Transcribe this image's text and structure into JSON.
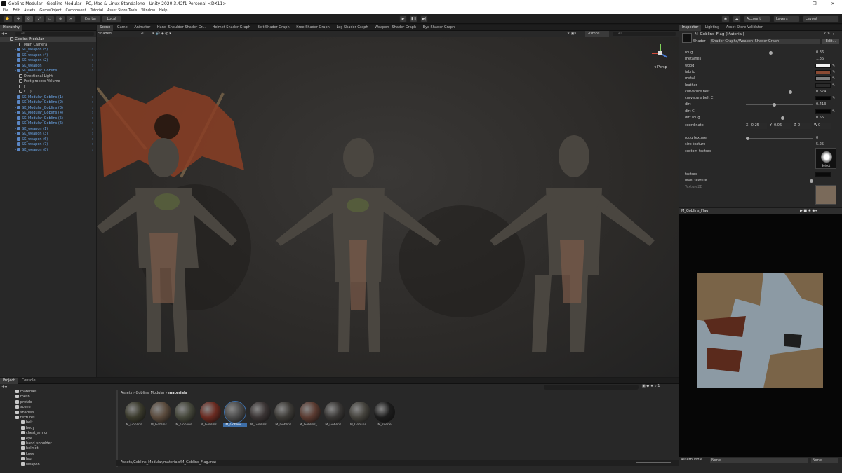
{
  "window": {
    "title": "Goblins Modular - Goblins_Modular - PC, Mac & Linux Standalone - Unity 2020.3.42f1 Personal <DX11>"
  },
  "menu": [
    "File",
    "Edit",
    "Assets",
    "GameObject",
    "Component",
    "Tutorial",
    "Asset Store Tools",
    "Window",
    "Help"
  ],
  "toolbar": {
    "center": "Center",
    "local": "Local",
    "account": "Account",
    "layers": "Layers",
    "layout": "Layout"
  },
  "hierarchy": {
    "tab": "Hierarchy",
    "search_placeholder": "All",
    "scene": "Goblins_Modular",
    "items": [
      {
        "label": "Main Camera",
        "blue": false
      },
      {
        "label": "SK_weapon (5)",
        "blue": true
      },
      {
        "label": "SK_weapon (4)",
        "blue": true
      },
      {
        "label": "SK_weapon (2)",
        "blue": true
      },
      {
        "label": "SK_weapon",
        "blue": true
      },
      {
        "label": "SK_Modular_Goblins",
        "blue": true
      },
      {
        "label": "Directional Light",
        "blue": false
      },
      {
        "label": "Post-process Volume",
        "blue": false
      },
      {
        "label": "r",
        "blue": false
      },
      {
        "label": "r (1)",
        "blue": false
      },
      {
        "label": "SK_Modular_Goblins (1)",
        "blue": true
      },
      {
        "label": "SK_Modular_Goblins (2)",
        "blue": true
      },
      {
        "label": "SK_Modular_Goblins (3)",
        "blue": true
      },
      {
        "label": "SK_Modular_Goblins (4)",
        "blue": true
      },
      {
        "label": "SK_Modular_Goblins (5)",
        "blue": true
      },
      {
        "label": "SK_Modular_Goblins (6)",
        "blue": true
      },
      {
        "label": "SK_weapon (1)",
        "blue": true
      },
      {
        "label": "SK_weapon (3)",
        "blue": true
      },
      {
        "label": "SK_weapon (6)",
        "blue": true
      },
      {
        "label": "SK_weapon (7)",
        "blue": true
      },
      {
        "label": "SK_weapon (8)",
        "blue": true
      }
    ]
  },
  "scene_tabs": [
    "Scene",
    "Game",
    "Animator",
    "Hand_Shoulder Shader Gr...",
    "Helmet Shader Graph",
    "Belt Shader Graph",
    "Kree Shader Graph",
    "Leg Shader Graph",
    "Weapon_ Shader Graph",
    "Eye Shader Graph"
  ],
  "scene": {
    "shading": "Shaded",
    "mode_2d": "2D",
    "gizmos": "Gizmos",
    "search_placeholder": "All",
    "persp": "< Persp"
  },
  "inspector": {
    "tabs": [
      "Inspector",
      "Lighting",
      "Asset Store Validator"
    ],
    "material_name": "M_Goblins_Flag (Material)",
    "shader_label": "Shader",
    "shader_value": "Shader Graphs/Weapon_Shader Graph",
    "edit": "Edit...",
    "props": [
      {
        "name": "roug",
        "value": "0.36",
        "slider": 0.36
      },
      {
        "name": "metalnes",
        "value": "1.36"
      },
      {
        "name": "wood",
        "color": "#f2f2f2"
      },
      {
        "name": "fabric",
        "color": "#8a4a33"
      },
      {
        "name": "metal",
        "color": "#7d7d7d"
      },
      {
        "name": "leather",
        "color": "#2a2a2a"
      },
      {
        "name": "curvature belt",
        "value": "0.674",
        "slider": 0.674
      },
      {
        "name": "curvature belt C",
        "color": "#050505"
      },
      {
        "name": "dirt",
        "value": "0.413",
        "slider": 0.413
      },
      {
        "name": "dirt C",
        "color": "#050505"
      },
      {
        "name": "dirt roug",
        "value": "0.55",
        "slider": 0.55
      }
    ],
    "coordinate": {
      "label": "coordinate",
      "x_label": "X",
      "x": "-0.25",
      "y_label": "Y",
      "y": "0.06",
      "z_label": "Z",
      "z": "0",
      "w_label": "W",
      "w": "0"
    },
    "props2": [
      {
        "name": "roug texture",
        "value": "0",
        "slider": 0
      },
      {
        "name": "size texture",
        "value": "5.25"
      },
      {
        "name": "custom texture"
      }
    ],
    "select": "Select",
    "texture_label": "texture",
    "level_label": "level texture",
    "level_value": "1",
    "level_slider": 1,
    "texture2d": "Texture2D"
  },
  "preview": {
    "title": "M_Goblins_Flag"
  },
  "assetbundle": {
    "label": "AssetBundle",
    "value": "None",
    "variant": "None"
  },
  "project": {
    "tabs": [
      "Project",
      "Console"
    ],
    "folders": [
      "materials",
      "mesh",
      "prefab",
      "scene",
      "shaders",
      "textures",
      "belt",
      "body",
      "chest_armor",
      "eye",
      "hand_shoulder",
      "helmet",
      "knee",
      "leg",
      "weapon"
    ],
    "breadcrumb": [
      "Assets",
      "Goblins_Modular",
      "materials"
    ],
    "assets": [
      "M_Goblins...",
      "M_Goblins...",
      "M_Goblins...",
      "M_Goblins...",
      "M_Goblins...",
      "M_Goblins...",
      "M_Goblins...",
      "M_Goblins_...",
      "M_Goblins...",
      "M_Goblins...",
      "M_scene"
    ],
    "path": "Assets/Goblins_Modular/materials/M_Goblins_Flag.mat"
  }
}
